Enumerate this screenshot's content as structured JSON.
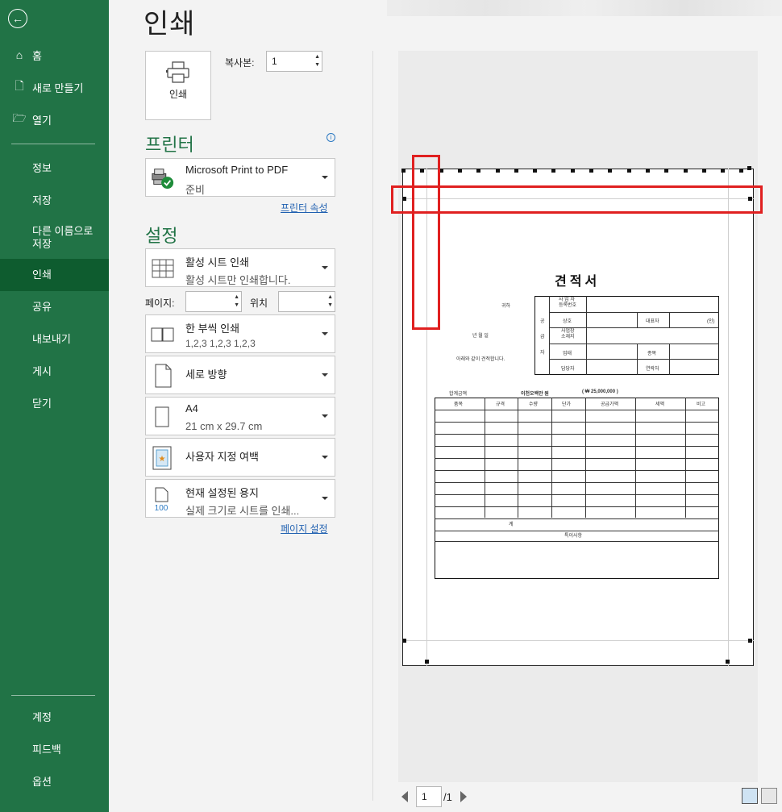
{
  "sidebar": {
    "back_label": "←",
    "top": [
      {
        "icon": "home-icon",
        "label": "홈"
      },
      {
        "icon": "new-file-icon",
        "label": "새로 만들기"
      },
      {
        "icon": "folder-open-icon",
        "label": "열기"
      }
    ],
    "sub": [
      "정보",
      "저장",
      "다른 이름으로 저장",
      "인쇄",
      "공유",
      "내보내기",
      "게시",
      "닫기"
    ],
    "bottom": [
      "계정",
      "피드백",
      "옵션"
    ]
  },
  "main": {
    "title": "인쇄",
    "print_button": "인쇄",
    "copies_label": "복사본:",
    "copies_value": "1",
    "printer_heading": "프린터",
    "printer": {
      "name": "Microsoft Print to PDF",
      "status": "준비"
    },
    "printer_props_link": "프린터 속성",
    "settings_heading": "설정",
    "settings": [
      {
        "icon": "sheet-icon",
        "line1": "활성 시트 인쇄",
        "line2": "활성 시트만 인쇄합니다."
      },
      {
        "icon": "collate-icon",
        "line1": "한 부씩 인쇄",
        "line2": "1,2,3     1,2,3     1,2,3"
      },
      {
        "icon": "portrait-icon",
        "line1": "세로 방향",
        "line2": ""
      },
      {
        "icon": "paper-size-icon",
        "line1": "A4",
        "line2": "21 cm x 29.7 cm"
      },
      {
        "icon": "margins-icon",
        "line1": "사용자 지정 여백",
        "line2": ""
      },
      {
        "icon": "scaling-icon",
        "line1": "현재 설정된 용지",
        "line2": "실제 크기로 시트를 인쇄..."
      }
    ],
    "pages_label": "페이지:",
    "position_label": "위치",
    "page_setup_link": "페이지 설정"
  },
  "preview": {
    "doc_title": "견적서",
    "labels": {
      "to": "귀하",
      "date": "년   월   일",
      "note": "아래와 같이 견적합니다.",
      "reg": "사 업 자\n등록번호",
      "company": "상호",
      "rep": "대표자",
      "seal": "(인)",
      "addr": "사업장\n소재지",
      "biz": "업태",
      "item": "종목",
      "manager": "담당자",
      "contact": "연락처",
      "v1": "공",
      "v2": "급",
      "v3": "자",
      "total_label": "합계금액",
      "total_korean": "이천오백만   원",
      "total_num": "(   ₩         25,000,000   )",
      "col_item": "품목",
      "col_spec": "규격",
      "col_qty": "수량",
      "col_price": "단가",
      "col_supply": "공급가액",
      "col_tax": "세액",
      "col_note": "비고",
      "sum": "계",
      "remarks": "특이사항"
    }
  },
  "pager": {
    "current": "1",
    "total": "/1"
  }
}
